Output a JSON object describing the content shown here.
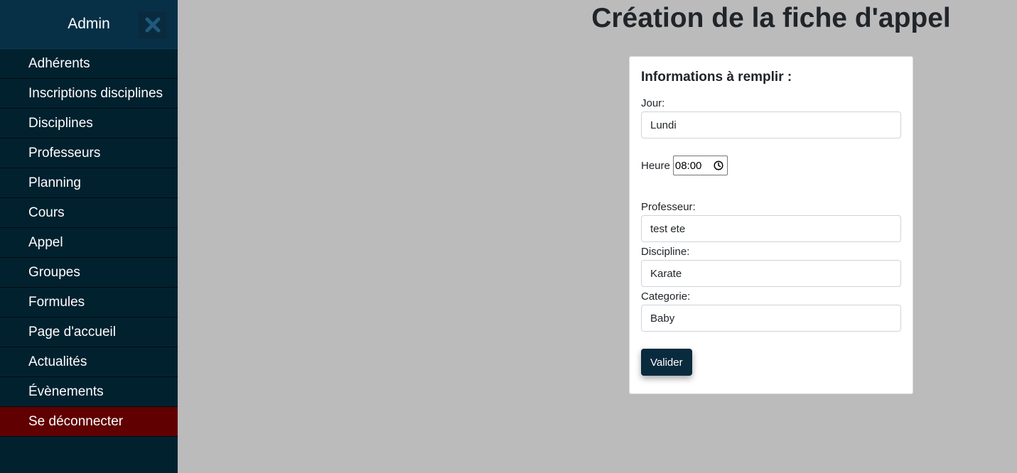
{
  "sidebar": {
    "title": "Admin",
    "close_icon": "close-icon",
    "items": [
      {
        "label": "Adhérents"
      },
      {
        "label": "Inscriptions disciplines"
      },
      {
        "label": "Disciplines"
      },
      {
        "label": "Professeurs"
      },
      {
        "label": "Planning"
      },
      {
        "label": "Cours"
      },
      {
        "label": "Appel"
      },
      {
        "label": "Groupes"
      },
      {
        "label": "Formules"
      },
      {
        "label": "Page d'accueil"
      },
      {
        "label": "Actualités"
      },
      {
        "label": "Évènements"
      }
    ],
    "logout_label": "Se déconnecter"
  },
  "page": {
    "title": "Création de la fiche d'appel"
  },
  "form": {
    "title": "Informations à remplir :",
    "jour_label": "Jour:",
    "jour_value": "Lundi",
    "heure_label": "Heure",
    "heure_value": "08:00",
    "professeur_label": "Professeur:",
    "professeur_value": "test ete",
    "discipline_label": "Discipline:",
    "discipline_value": "Karate",
    "categorie_label": "Categorie:",
    "categorie_value": "Baby",
    "submit_label": "Valider"
  },
  "colors": {
    "sidebar_bg": "#02212f",
    "sidebar_header_bg": "#073047",
    "logout_bg": "#600000",
    "button_bg": "#0a2a3e",
    "page_bg": "#bbbbbb"
  }
}
